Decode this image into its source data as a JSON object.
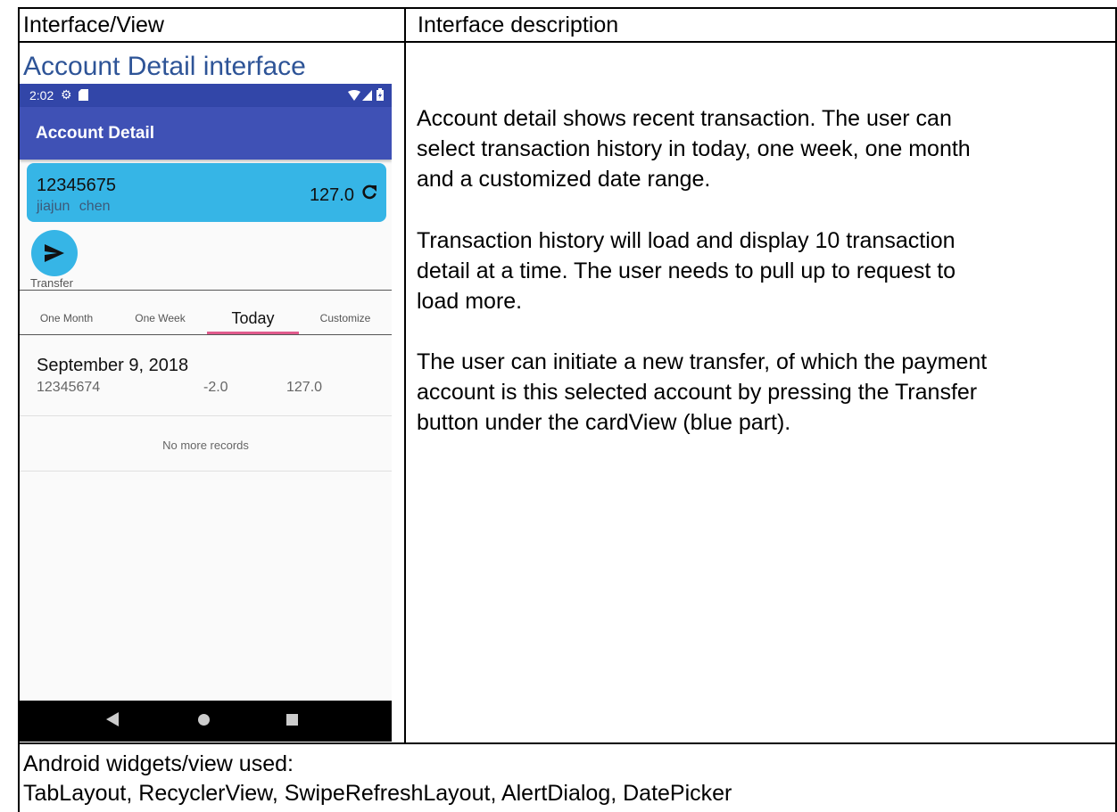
{
  "table": {
    "header_left": "Interface/View",
    "header_right": "Interface description",
    "interface_title": "Account Detail interface",
    "description": [
      "Account detail shows recent transaction. The user can",
      "select transaction history in today, one week, one month",
      "and a customized date range.",
      "Transaction history will load and display 10 transaction",
      "detail at a time. The user needs to pull up to request to",
      "load more.",
      "The user can initiate a new transfer, of which the payment",
      "account is this selected account by pressing the Transfer",
      "button under the cardView (blue part)."
    ],
    "widgets_label": "Android widgets/view used:",
    "widgets_list": "TabLayout, RecyclerView, SwipeRefreshLayout, AlertDialog, DatePicker"
  },
  "phone": {
    "status_time": "2:02",
    "appbar_title": "Account Detail",
    "account": {
      "number": "12345675",
      "owner": "jiajun chen",
      "balance": "127.0"
    },
    "transfer_label": "Transfer",
    "tabs": [
      "One Month",
      "One Week",
      "Today",
      "Customize"
    ],
    "selected_tab": "Today",
    "transactions": [
      {
        "date": "September 9, 2018",
        "account": "12345674",
        "amount": "-2.0",
        "balance": "127.0"
      }
    ],
    "no_more_label": "No more records",
    "colors": {
      "status_bar": "#3246a8",
      "app_bar": "#3f51b5",
      "card": "#36b5e6",
      "tab_indicator": "#e05a8c",
      "title_blue": "#2e5497"
    },
    "icons": [
      "gear-icon",
      "sd-card-icon",
      "wifi-icon",
      "signal-icon",
      "battery-icon",
      "refresh-icon",
      "send-icon",
      "back-icon",
      "home-icon",
      "recents-icon"
    ]
  }
}
